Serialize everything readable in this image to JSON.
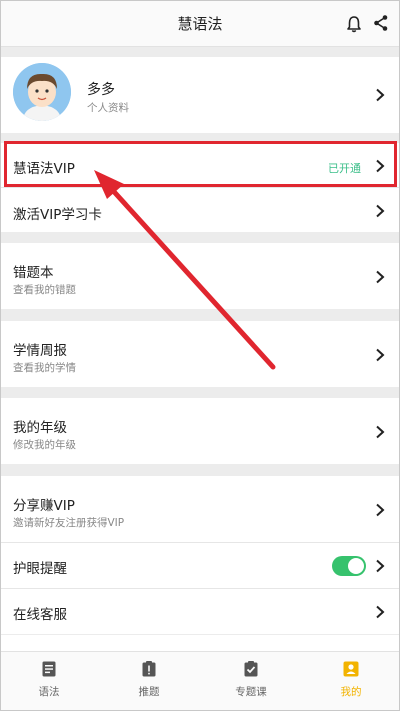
{
  "header": {
    "title": "慧语法"
  },
  "profile": {
    "name": "多多",
    "subtitle": "个人资料"
  },
  "menu": {
    "vip": {
      "label": "慧语法VIP",
      "status": "已开通"
    },
    "activate_card": {
      "label": "激活VIP学习卡"
    },
    "wrong_book": {
      "label": "错题本",
      "subtitle": "查看我的错题"
    },
    "weekly_report": {
      "label": "学情周报",
      "subtitle": "查看我的学情"
    },
    "my_grade": {
      "label": "我的年级",
      "subtitle": "修改我的年级"
    },
    "share_vip": {
      "label": "分享赚VIP",
      "subtitle": "邀请新好友注册获得VIP"
    },
    "eye_care": {
      "label": "护眼提醒",
      "enabled": true
    },
    "online_service": {
      "label": "在线客服"
    }
  },
  "bottom_nav": [
    {
      "label": "语法",
      "icon": "document-icon",
      "active": false
    },
    {
      "label": "推题",
      "icon": "exclamation-clipboard-icon",
      "active": false
    },
    {
      "label": "专题课",
      "icon": "check-clipboard-icon",
      "active": false
    },
    {
      "label": "我的",
      "icon": "profile-icon",
      "active": true
    }
  ],
  "colors": {
    "accent_green": "#3cbf8a",
    "toggle_on": "#36c26d",
    "highlight_red": "#e0262f",
    "active_tab": "#f2b300"
  }
}
